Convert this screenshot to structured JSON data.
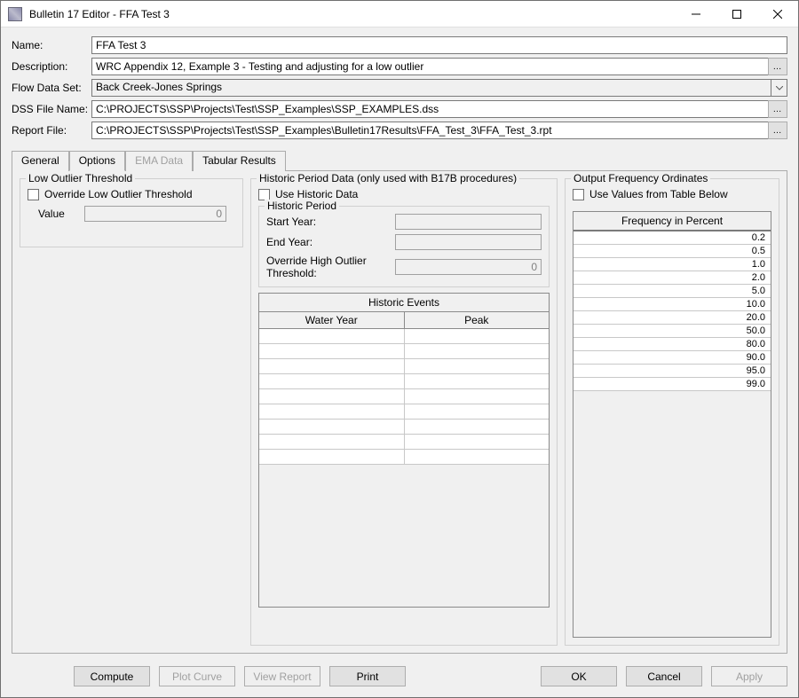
{
  "window": {
    "title": "Bulletin 17 Editor - FFA Test 3"
  },
  "form": {
    "name_label": "Name:",
    "name_value": "FFA Test 3",
    "description_label": "Description:",
    "description_value": "WRC Appendix 12, Example 3 - Testing and adjusting for a low outlier",
    "flowdata_label": "Flow Data Set:",
    "flowdata_value": "Back Creek-Jones Springs",
    "dssfile_label": "DSS File Name:",
    "dssfile_value": "C:\\PROJECTS\\SSP\\Projects\\Test\\SSP_Examples\\SSP_EXAMPLES.dss",
    "reportfile_label": "Report File:",
    "reportfile_value": "C:\\PROJECTS\\SSP\\Projects\\Test\\SSP_Examples\\Bulletin17Results\\FFA_Test_3\\FFA_Test_3.rpt"
  },
  "tabs": {
    "general": "General",
    "options": "Options",
    "ema": "EMA Data",
    "tabular": "Tabular Results"
  },
  "low_outlier": {
    "group": "Low Outlier Threshold",
    "override": "Override Low Outlier Threshold",
    "value_label": "Value",
    "value": "0"
  },
  "historic": {
    "group": "Historic Period Data (only used with B17B procedures)",
    "use": "Use Historic Data",
    "period": "Historic Period",
    "start": "Start Year:",
    "end": "End Year:",
    "override_high": "Override High Outlier Threshold:",
    "override_high_value": "0",
    "events_title": "Historic Events",
    "col_water_year": "Water Year",
    "col_peak": "Peak"
  },
  "output": {
    "group": "Output Frequency Ordinates",
    "use_table": "Use Values from Table Below",
    "freq_header": "Frequency in Percent",
    "values": [
      "0.2",
      "0.5",
      "1.0",
      "2.0",
      "5.0",
      "10.0",
      "20.0",
      "50.0",
      "80.0",
      "90.0",
      "95.0",
      "99.0"
    ]
  },
  "buttons": {
    "compute": "Compute",
    "plot": "Plot Curve",
    "view": "View Report",
    "print": "Print",
    "ok": "OK",
    "cancel": "Cancel",
    "apply": "Apply"
  }
}
